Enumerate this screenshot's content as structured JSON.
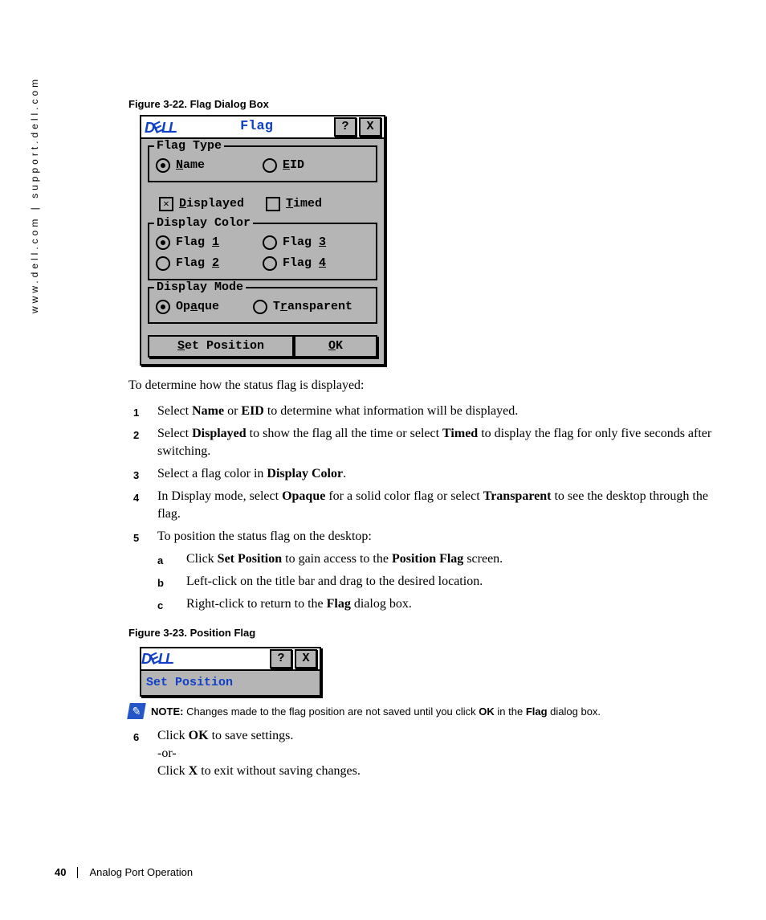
{
  "side_url": "www.dell.com | support.dell.com",
  "fig1_caption": "Figure 3-22.    Flag Dialog Box",
  "fig2_caption": "Figure 3-23.    Position Flag",
  "dialog": {
    "title": "Flag",
    "groups": {
      "flag_type": {
        "legend": "Flag Type",
        "options": [
          {
            "label": "Name",
            "u": "N",
            "selected": true
          },
          {
            "label": "EID",
            "u": "E",
            "selected": false
          }
        ]
      },
      "mid": [
        {
          "label": "Displayed",
          "u": "D",
          "type": "check",
          "selected": true
        },
        {
          "label": "Timed",
          "u": "T",
          "type": "check",
          "selected": false
        }
      ],
      "display_color": {
        "legend": "Display Color",
        "options": [
          {
            "label": "Flag 1",
            "u": "1",
            "selected": true
          },
          {
            "label": "Flag 3",
            "u": "3",
            "selected": false
          },
          {
            "label": "Flag 2",
            "u": "2",
            "selected": false
          },
          {
            "label": "Flag 4",
            "u": "4",
            "selected": false
          }
        ]
      },
      "display_mode": {
        "legend": "Display Mode",
        "options": [
          {
            "label": "Opaque",
            "u": "a",
            "selected": true
          },
          {
            "label": "Transparent",
            "u": "r",
            "selected": false
          }
        ]
      }
    },
    "buttons": {
      "set_position": "Set Position",
      "ok": "OK"
    }
  },
  "pos_dialog": {
    "body": "Set Position"
  },
  "intro": "To determine how the status flag is displayed:",
  "steps": [
    {
      "n": "1",
      "html": "Select <b>Name</b> or <b>EID</b> to determine what information will be displayed."
    },
    {
      "n": "2",
      "html": "Select <b>Displayed</b> to show the flag all the time or select <b>Timed</b> to display the flag for only five seconds after switching."
    },
    {
      "n": "3",
      "html": "Select a flag color in <b>Display Color</b>."
    },
    {
      "n": "4",
      "html": "In Display mode, select <b>Opaque</b> for a solid color flag or select <b>Transparent</b> to see the desktop through the flag."
    },
    {
      "n": "5",
      "html": "To position the status flag on the desktop:",
      "sub": [
        {
          "n": "a",
          "html": "Click <b>Set Position</b> to gain access to the <b>Position Flag</b> screen."
        },
        {
          "n": "b",
          "html": "Left-click on the title bar and drag to the desired location."
        },
        {
          "n": "c",
          "html": "Right-click to return to the <b>Flag</b> dialog box."
        }
      ]
    }
  ],
  "note": {
    "label": "NOTE:",
    "text": " Changes made to the flag position are not saved until you click ",
    "b1": "OK",
    "t2": " in the ",
    "b2": "Flag",
    "t3": " dialog box."
  },
  "step6": {
    "n": "6",
    "l1_a": "Click ",
    "l1_b": "OK",
    "l1_c": " to save settings.",
    "l2": "-or-",
    "l3_a": "Click ",
    "l3_b": "X",
    "l3_c": " to exit without saving changes."
  },
  "footer": {
    "page": "40",
    "section": "Analog Port Operation"
  },
  "icons": {
    "help": "?",
    "close": "X",
    "note": "✎"
  }
}
